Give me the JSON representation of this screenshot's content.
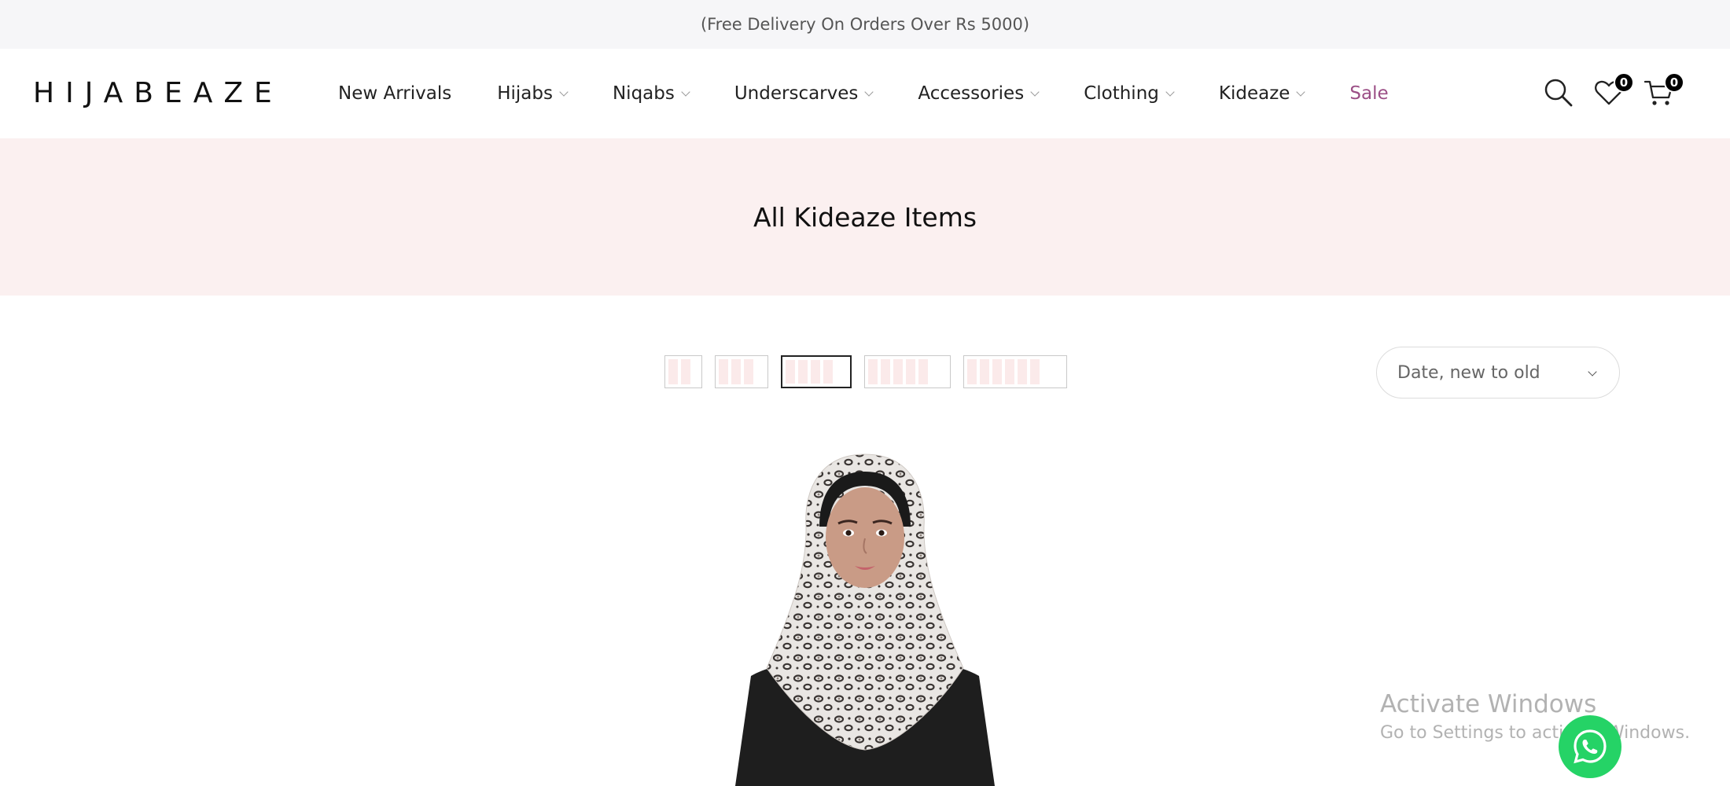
{
  "topbar": {
    "promo_text": "(Free Delivery On Orders Over Rs 5000)"
  },
  "header": {
    "logo": "HIJABEAZE",
    "nav": [
      {
        "label": "New Arrivals",
        "dropdown": false
      },
      {
        "label": "Hijabs",
        "dropdown": true
      },
      {
        "label": "Niqabs",
        "dropdown": true
      },
      {
        "label": "Underscarves",
        "dropdown": true
      },
      {
        "label": "Accessories",
        "dropdown": true
      },
      {
        "label": "Clothing",
        "dropdown": true
      },
      {
        "label": "Kideaze",
        "dropdown": true
      },
      {
        "label": "Sale",
        "dropdown": false
      }
    ],
    "wishlist_count": "0",
    "cart_count": "0",
    "icons": [
      "search-icon",
      "heart-icon",
      "cart-icon"
    ]
  },
  "hero": {
    "title": "All Kideaze Items"
  },
  "toolbar": {
    "grid_options": [
      2,
      3,
      4,
      5,
      6
    ],
    "active_grid": 4,
    "sort_value": "Date, new to old"
  },
  "watermark": {
    "line1": "Activate Windows",
    "line2": "Go to Settings to activate Windows."
  },
  "colors": {
    "sale": "#9b4f86",
    "hero_bg": "#fbf0f0",
    "whatsapp": "#25d366"
  }
}
